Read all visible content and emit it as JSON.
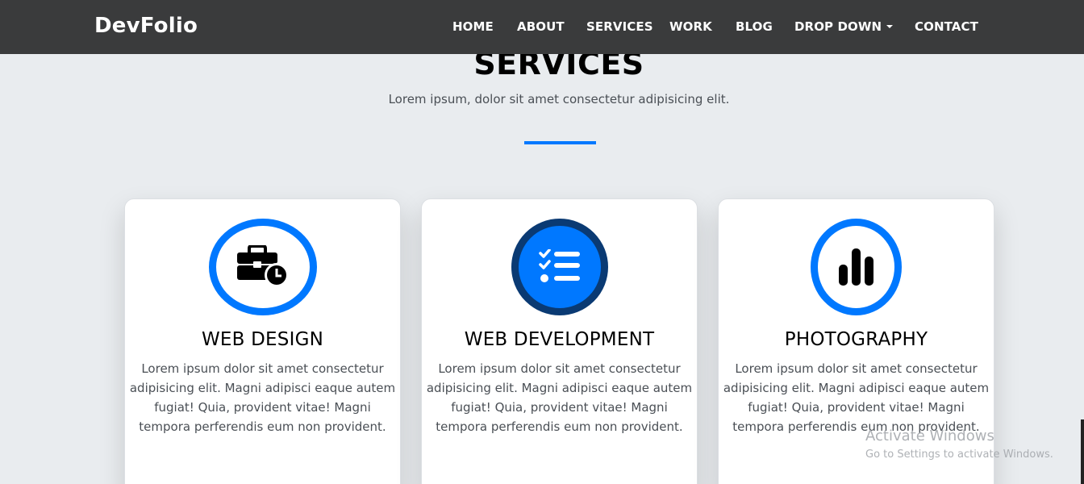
{
  "brand": "DevFolio",
  "nav": {
    "items": [
      "HOME",
      "ABOUT",
      "SERVICES",
      "WORK",
      "BLOG",
      "DROP DOWN",
      "CONTACT"
    ]
  },
  "section": {
    "title": "SERVICES",
    "subtitle": "Lorem ipsum, dolor sit amet consectetur adipisicing elit."
  },
  "cards": [
    {
      "icon": "briefcase-clock-icon",
      "title": "WEB DESIGN",
      "lines": [
        "Lorem ipsum dolor sit amet consectetur",
        "adipisicing elit. Magni adipisci eaque autem",
        "fugiat! Quia, provident vitae! Magni",
        "tempora perferendis eum non provident."
      ]
    },
    {
      "icon": "checklist-icon",
      "title": "WEB DEVELOPMENT",
      "lines": [
        "Lorem ipsum dolor sit amet consectetur",
        "adipisicing elit. Magni adipisci eaque autem",
        "fugiat! Quia, provident vitae! Magni",
        "tempora perferendis eum non provident."
      ]
    },
    {
      "icon": "bar-chart-icon",
      "title": "PHOTOGRAPHY",
      "lines": [
        "Lorem ipsum dolor sit amet consectetur",
        "adipisicing elit. Magni adipisci eaque autem",
        "fugiat! Quia, provident vitae! Magni",
        "tempora perferendis eum non provident."
      ]
    }
  ],
  "watermark": {
    "title": "Activate Windows",
    "subtitle": "Go to Settings to activate Windows."
  },
  "colors": {
    "navbar": "#3a3b3c",
    "accent": "#0078ff",
    "accent_dark": "#0a3a73",
    "page_bg": "#e9ecef"
  }
}
